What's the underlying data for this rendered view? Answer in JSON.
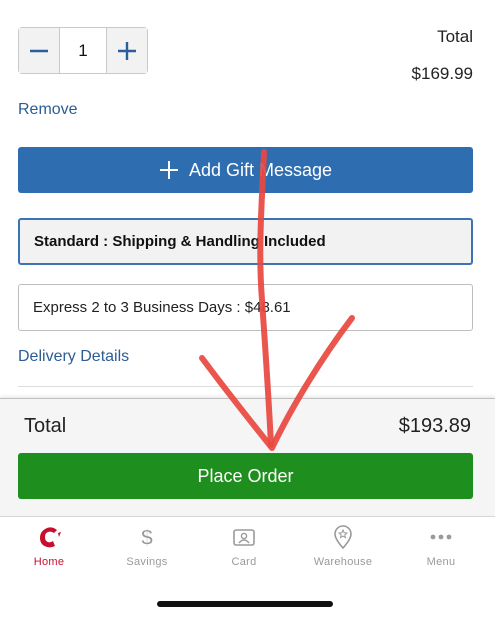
{
  "cart_item": {
    "quantity": "1",
    "total_label": "Total",
    "total_value": "$169.99",
    "remove_label": "Remove"
  },
  "gift": {
    "label": "Add Gift Message"
  },
  "shipping": {
    "standard_label": "Standard : Shipping & Handling Included",
    "express_label": "Express 2 to 3 Business Days : $48.61"
  },
  "delivery_details_label": "Delivery Details",
  "order_summary": {
    "total_label": "Total",
    "total_value": "$193.89",
    "place_order_label": "Place Order"
  },
  "tabs": [
    {
      "label": "Home",
      "icon": "costco-logo-icon",
      "active": true
    },
    {
      "label": "Savings",
      "icon": "dollar-icon",
      "active": false
    },
    {
      "label": "Card",
      "icon": "member-card-icon",
      "active": false
    },
    {
      "label": "Warehouse",
      "icon": "location-pin-icon",
      "active": false
    },
    {
      "label": "Menu",
      "icon": "more-dots-icon",
      "active": false
    }
  ],
  "colors": {
    "link": "#2c5d94",
    "primary_button": "#2d6db0",
    "place_order": "#1e8f1e",
    "active_tab": "#c8102e",
    "annotation": "#e8483f"
  }
}
